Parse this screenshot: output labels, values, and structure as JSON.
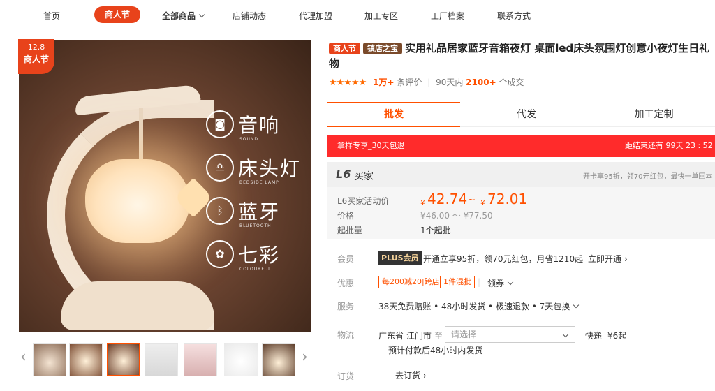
{
  "nav": {
    "items": [
      "首页",
      "商人节",
      "全部商品",
      "店铺动态",
      "代理加盟",
      "加工专区",
      "工厂档案",
      "联系方式"
    ]
  },
  "badge": {
    "date": "12.8",
    "label": "商人节"
  },
  "features": [
    {
      "icon": "speaker-icon",
      "label": "音响",
      "sub": "SOUND"
    },
    {
      "icon": "lamp-icon",
      "label": "床头灯",
      "sub": "BEDSIDE LAMP"
    },
    {
      "icon": "bluetooth-icon",
      "label": "蓝牙",
      "sub": "BLUETOOTH"
    },
    {
      "icon": "palette-icon",
      "label": "七彩",
      "sub": "COLOURFUL"
    }
  ],
  "product": {
    "tags": [
      "商人节",
      "镇店之宝"
    ],
    "title": "实用礼品居家蓝牙音箱夜灯 桌面led床头氛围灯创意小夜灯生日礼物",
    "rating_count": "1万+",
    "rating_suffix": "条评价",
    "sales_prefix": "90天内",
    "sales_count": "2100+",
    "sales_suffix": "个成交"
  },
  "tabs": [
    "批发",
    "代发",
    "加工定制"
  ],
  "promo": {
    "left": "拿样专享_30天包退",
    "right": "距结束还有 99天 23 : 52 : 39"
  },
  "vip": {
    "level": "L6",
    "label": "买家",
    "note": "开卡享95折，领70元红包，最快一单回本 ›"
  },
  "price": {
    "activity_label": "L6买家活动价",
    "low": "42.74",
    "high": "72.01",
    "currency": "¥",
    "tilde": "~",
    "orig_label": "价格",
    "orig_range": "¥46.00 ～ ¥77.50",
    "moq_label": "起批量",
    "moq": "1个起批"
  },
  "member": {
    "label": "会员",
    "badge": "PLUS会员",
    "text": "开通立享95折，领70元红包，月省1210起",
    "action": "立即开通 ›"
  },
  "discount": {
    "label": "优惠",
    "c1": "每200减20|跨店",
    "c2": "1件混批",
    "action": "领券"
  },
  "service": {
    "label": "服务",
    "text": "38天免费赔账 • 48小时发货 • 极速退款 • 7天包换"
  },
  "logistics": {
    "label": "物流",
    "from": "广东省  江门市",
    "to": "至",
    "placeholder": "请选择",
    "express": "快递",
    "fee": "¥6起",
    "note": "预计付款后48小时内发货"
  },
  "order": {
    "label": "订货",
    "action": "去订货 ›"
  }
}
